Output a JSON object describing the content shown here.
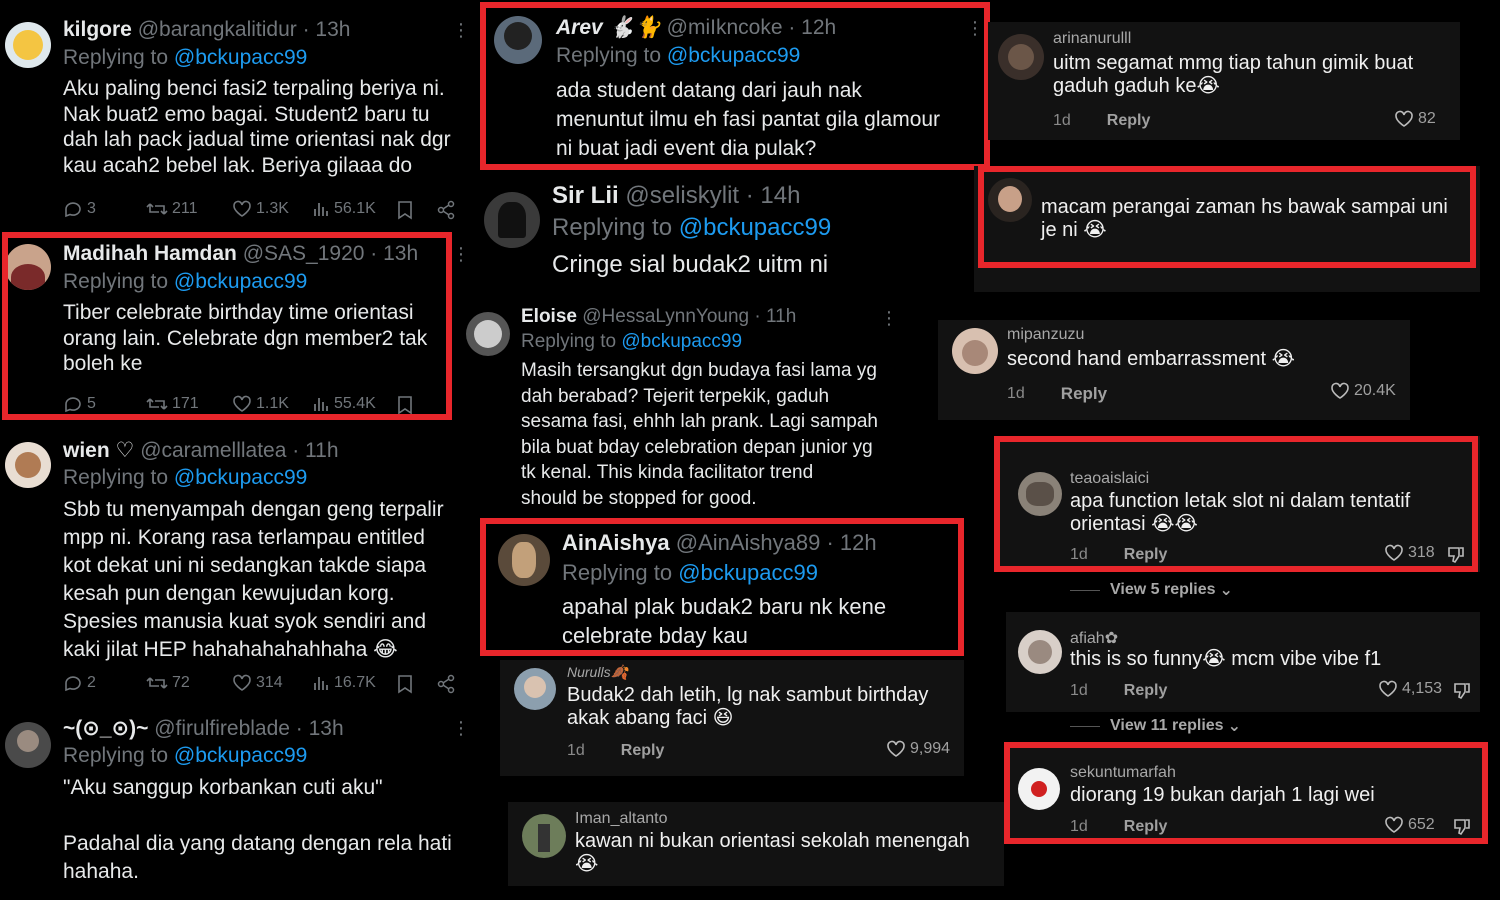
{
  "tweets": [
    {
      "name": "kilgore",
      "handle": "@barangkalitidur · 13h",
      "replying_prefix": "Replying to",
      "replying_to": "@bckupacc99",
      "lines": [
        "Aku paling benci fasi2 terpaling beriya ni.",
        "Nak buat2 emo bagai. Student2 baru tu",
        "dah lah pack jadual time orientasi nak dgr",
        "kau acah2 bebel lak. Beriya gilaaa do"
      ],
      "replies": "3",
      "retweets": "211",
      "likes": "1.3K",
      "views": "56.1K"
    },
    {
      "name": "Madihah Hamdan",
      "handle": "@SAS_1920 · 13h",
      "replying_prefix": "Replying to",
      "replying_to": "@bckupacc99",
      "lines": [
        "Tiber celebrate birthday time orientasi",
        "orang lain. Celebrate dgn member2 tak",
        "boleh ke"
      ],
      "replies": "5",
      "retweets": "171",
      "likes": "1.1K",
      "views": "55.4K"
    },
    {
      "name": "wien ♡",
      "handle": "@caramelllatea · 11h",
      "replying_prefix": "Replying to",
      "replying_to": "@bckupacc99",
      "lines": [
        "Sbb tu menyampah dengan geng terpalir",
        "mpp ni. Korang rasa terlampau entitled",
        "kot dekat uni ni sedangkan takde siapa",
        "kesah pun dengan kewujudan korg.",
        "Spesies manusia kuat syok sendiri and",
        "kaki jilat HEP hahahahahahhaha 😂"
      ],
      "replies": "2",
      "retweets": "72",
      "likes": "314",
      "views": "16.7K"
    },
    {
      "name": "~(⊙_⊙)~",
      "handle": "@firulfireblade · 13h",
      "replying_prefix": "Replying to",
      "replying_to": "@bckupacc99",
      "lines": [
        "\"Aku sanggup korbankan cuti aku\"",
        "",
        "Padahal dia yang datang dengan rela hati",
        "hahaha."
      ]
    },
    {
      "name": "Arev 🐇🐈",
      "handle": "@miIkncoke · 12h",
      "replying_prefix": "Replying to",
      "replying_to": "@bckupacc99",
      "lines": [
        "ada student datang dari jauh nak",
        "menuntut ilmu eh fasi pantat gila glamour",
        "ni buat jadi event dia pulak?"
      ]
    },
    {
      "name": "Sir Lii",
      "handle": "@seliskylit · 14h",
      "replying_prefix": "Replying to",
      "replying_to": "@bckupacc99",
      "lines": [
        "Cringe sial budak2 uitm ni"
      ]
    },
    {
      "name": "Eloise",
      "handle": "@HessaLynnYoung · 11h",
      "replying_prefix": "Replying to",
      "replying_to": "@bckupacc99",
      "lines": [
        "Masih tersangkut dgn budaya fasi lama yg",
        "dah berabad? Tejerit terpekik, gaduh",
        "sesama fasi, ehhh lah prank. Lagi sampah",
        "bila buat bday celebration depan junior yg",
        "tk kenal. This kinda facilitator trend",
        "should be stopped for good."
      ]
    },
    {
      "name": "AinAishya",
      "handle": "@AinAishya89 · 12h",
      "replying_prefix": "Replying to",
      "replying_to": "@bckupacc99",
      "lines": [
        "apahal plak budak2 baru nk kene",
        "celebrate bday kau"
      ]
    }
  ],
  "tiktok": [
    {
      "name": "arinanurulll",
      "lines": [
        "uitm segamat mmg tiap tahun gimik buat",
        "gaduh gaduh ke😭"
      ],
      "time": "1d",
      "reply": "Reply",
      "likes": "82"
    },
    {
      "name": "",
      "lines": [
        "macam perangai zaman hs bawak sampai uni",
        "je ni 😭"
      ],
      "time": "",
      "reply": "",
      "likes": ""
    },
    {
      "name": "mipanzuzu",
      "lines": [
        "second hand embarrassment 😭"
      ],
      "time": "1d",
      "reply": "Reply",
      "likes": "20.4K"
    },
    {
      "name": "teaoaislaici",
      "lines": [
        "apa function letak slot ni dalam tentatif",
        "orientasi 😭😭"
      ],
      "time": "1d",
      "reply": "Reply",
      "likes": "318"
    },
    {
      "name": "afiah✿",
      "lines": [
        "this is so funny😭 mcm vibe vibe f1"
      ],
      "time": "1d",
      "reply": "Reply",
      "likes": "4,153"
    },
    {
      "name": "sekuntumarfah",
      "lines": [
        "diorang 19 bukan darjah 1 lagi wei"
      ],
      "time": "1d",
      "reply": "Reply",
      "likes": "652"
    },
    {
      "name": "Nurulls🍂",
      "lines": [
        "Budak2 dah letih, lg nak sambut birthday",
        "akak abang faci 😆"
      ],
      "time": "1d",
      "reply": "Reply",
      "likes": "9,994"
    },
    {
      "name": "Iman_altanto",
      "lines": [
        "kawan ni bukan orientasi sekolah menengah",
        "😭"
      ],
      "time": "",
      "reply": "",
      "likes": ""
    }
  ],
  "view_replies": [
    "View 5 replies",
    "View 11 replies"
  ],
  "colors": {
    "highlight": "#e8262b",
    "link": "#1d9bf0",
    "muted": "#71767b"
  }
}
